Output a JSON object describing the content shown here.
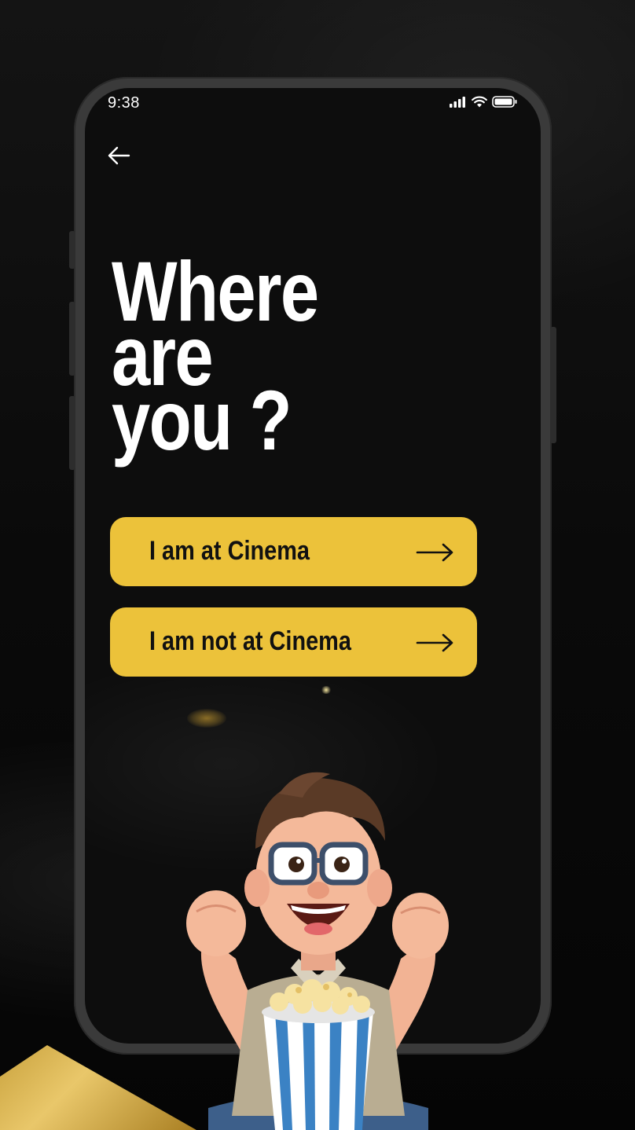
{
  "status_bar": {
    "time": "9:38",
    "icons": [
      "signal-icon",
      "wifi-icon",
      "battery-icon"
    ]
  },
  "nav": {
    "back_icon": "arrow-left-icon"
  },
  "heading": {
    "line1": "Where",
    "line2": "are",
    "line3": "you ?"
  },
  "options": [
    {
      "label": "I am at Cinema",
      "icon": "arrow-right-icon"
    },
    {
      "label": "I am not at Cinema",
      "icon": "arrow-right-icon"
    }
  ],
  "colors": {
    "accent": "#ecc23a",
    "background": "#0d0d0d",
    "text": "#ffffff",
    "button_text": "#111111"
  },
  "illustration": "cartoon-man-with-popcorn"
}
